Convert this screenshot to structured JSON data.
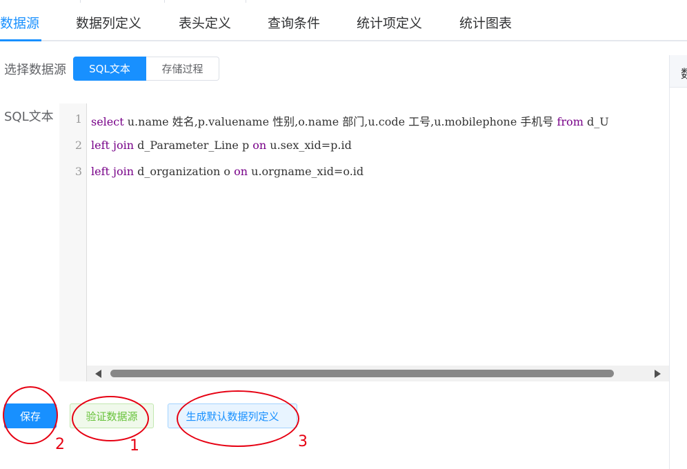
{
  "tabs": [
    "数据源",
    "数据列定义",
    "表头定义",
    "查询条件",
    "统计项定义",
    "统计图表"
  ],
  "active_tab": "数据源",
  "right_panel": {
    "header_partial": "数"
  },
  "source": {
    "label": "选择数据源",
    "options": [
      "SQL文本",
      "存储过程"
    ],
    "selected": "SQL文本"
  },
  "sql": {
    "label": "SQL文本",
    "line_numbers": [
      "1",
      "2",
      "3"
    ],
    "lines": [
      [
        {
          "t": "select",
          "kw": true
        },
        {
          "t": " u.name 姓名,p.valuename 性别,o.name 部门,u.code 工号,u.mobilephone 手机号 ",
          "kw": false
        },
        {
          "t": "from",
          "kw": true
        },
        {
          "t": " d_U",
          "kw": false
        }
      ],
      [
        {
          "t": "left join",
          "kw": true
        },
        {
          "t": " d_Parameter_Line p ",
          "kw": false
        },
        {
          "t": "on",
          "kw": true
        },
        {
          "t": " u.sex_xid=p.id",
          "kw": false
        }
      ],
      [
        {
          "t": "left join",
          "kw": true
        },
        {
          "t": " d_organization o ",
          "kw": false
        },
        {
          "t": "on",
          "kw": true
        },
        {
          "t": " u.orgname_xid=o.id",
          "kw": false
        }
      ]
    ]
  },
  "buttons": {
    "save": "保存",
    "verify": "验证数据源",
    "generate": "生成默认数据列定义"
  },
  "annotations": [
    "2",
    "1",
    "3"
  ],
  "colors": {
    "accent": "#1890ff",
    "keyword": "#770088",
    "success": "#67c23a",
    "annotation": "#e60012"
  }
}
